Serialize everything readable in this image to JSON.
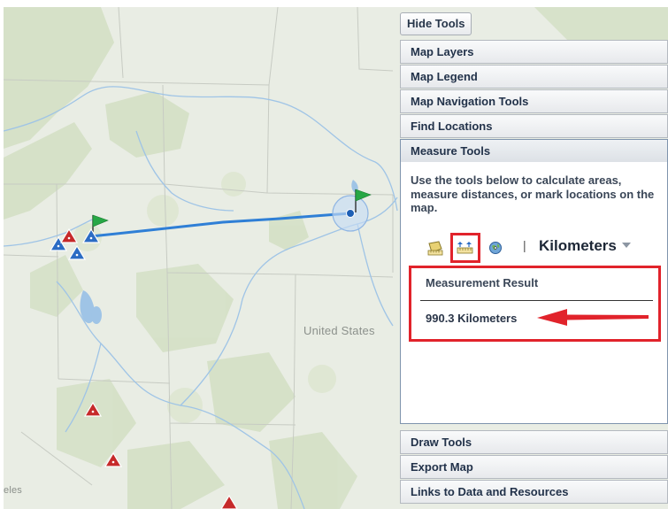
{
  "map": {
    "labels": {
      "country": "United States",
      "city_fragment": "eles"
    },
    "colors": {
      "land": "#e9ede4",
      "forest": "#d4dfc4",
      "river": "#9dc3e6",
      "boundary": "#c9cdc6",
      "measure_line": "#2f7fd6"
    },
    "icons": [
      "green-flag-icon",
      "blue-triangle-marker-icon",
      "red-triangle-marker-icon",
      "measure-endpoint-icon"
    ]
  },
  "tools": {
    "hide_label": "Hide Tools",
    "sections": {
      "layers": "Map Layers",
      "legend": "Map Legend",
      "navigation": "Map Navigation Tools",
      "find": "Find Locations",
      "measure": "Measure Tools",
      "draw": "Draw Tools",
      "export": "Export Map",
      "links": "Links to Data and Resources"
    },
    "measure": {
      "instructions": "Use the tools below to calculate areas, measure distances, or mark locations on the map.",
      "separator": "|",
      "unit": "Kilometers",
      "result_title": "Measurement Result",
      "result_value": "990.3 Kilometers"
    },
    "colors": {
      "highlight": "#e1232b",
      "header_text": "#22324a"
    }
  }
}
